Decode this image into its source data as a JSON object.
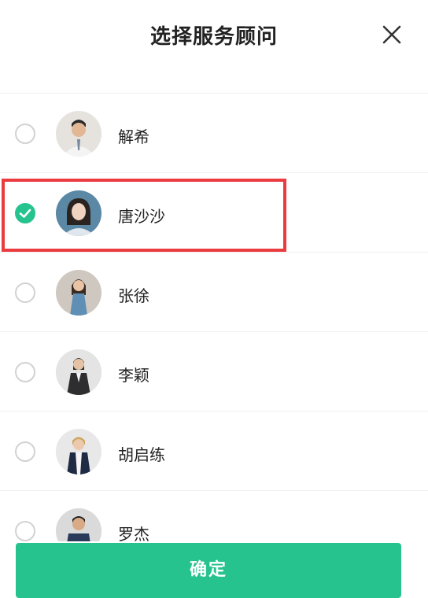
{
  "header": {
    "title": "选择服务顾问",
    "close_icon": "close-icon"
  },
  "advisors": [
    {
      "name": "",
      "selected": false
    },
    {
      "name": "解希",
      "selected": false
    },
    {
      "name": "唐沙沙",
      "selected": true
    },
    {
      "name": "张徐",
      "selected": false
    },
    {
      "name": "李颖",
      "selected": false
    },
    {
      "name": "胡启练",
      "selected": false
    },
    {
      "name": "罗杰",
      "selected": false
    }
  ],
  "footer": {
    "confirm_label": "确定"
  },
  "colors": {
    "accent": "#27c38f",
    "highlight_border": "#ea3b3e",
    "radio_border": "#d2d2d2"
  }
}
